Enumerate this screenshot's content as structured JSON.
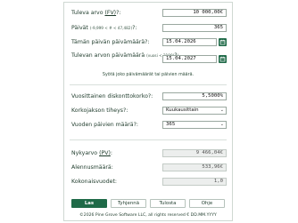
{
  "form": {
    "future_value": {
      "label": "Tuleva arvo",
      "abbr": "(FV)",
      "suffix": "?:",
      "value": "10 000,00€"
    },
    "days": {
      "label": "Päivät",
      "range": "(-9,999 < # < 47,482)",
      "suffix": "?:",
      "value": "365"
    },
    "today_date": {
      "label": "Tämän päivän päivämäärä?:",
      "value": "15.04.2026"
    },
    "future_date": {
      "label": "Tulevan arvon päivämäärä",
      "note": "(vuosi < 2100)",
      "suffix": "?:",
      "value": "15.04.2027"
    },
    "hint": "Syötä joko päivämäärät tai päivien määrä.",
    "discount_rate": {
      "label": "Vuosittainen diskonttokorko?:",
      "value": "5,5000%"
    },
    "frequency": {
      "label": "Korkojakson tiheys?:",
      "value": "Kuukausittain"
    },
    "year_days": {
      "label": "Vuoden päivien määrä?:",
      "value": "365"
    }
  },
  "results": {
    "present_value": {
      "label": "Nykyarvo",
      "abbr": "(PV)",
      "suffix": ":",
      "value": "9 466,04€"
    },
    "discount_amount": {
      "label": "Alennusmäärä:",
      "value": "533,96€"
    },
    "total_years": {
      "label": "Kokonaisvuodet:",
      "value": "1,0"
    }
  },
  "buttons": {
    "calc": "Las",
    "clear": "Tyhjennä",
    "print": "Tulosta",
    "help": "Ohje"
  },
  "footer": "©2026 Pine Grove Software LLC, all rights reserved  €  DD.MM.YYYY",
  "colors": {
    "accent": "#1f6a48"
  },
  "icons": {
    "calendar": "calendar-icon",
    "dropdown": "chevron-down-icon"
  }
}
